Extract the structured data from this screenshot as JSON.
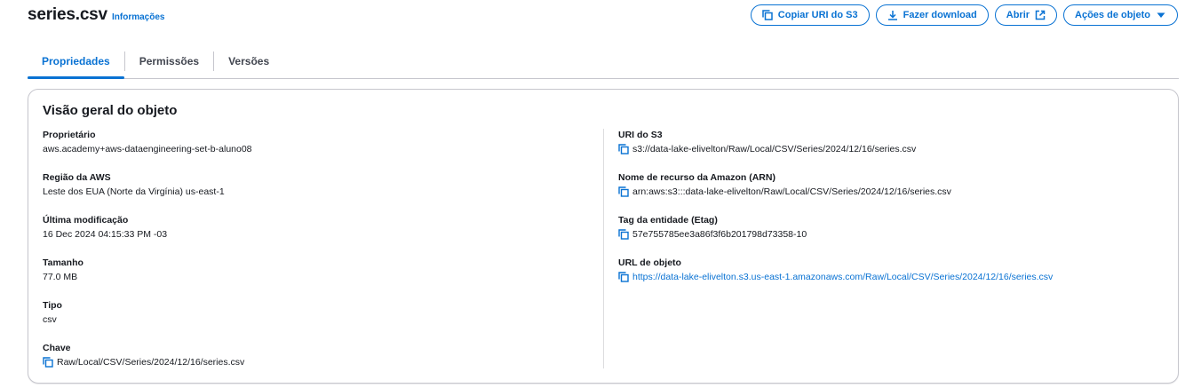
{
  "header": {
    "title": "series.csv",
    "info_link": "Informações"
  },
  "actions": {
    "copy_uri": "Copiar URI do S3",
    "download": "Fazer download",
    "open": "Abrir",
    "object_actions": "Ações de objeto"
  },
  "tabs": [
    {
      "label": "Propriedades",
      "active": true
    },
    {
      "label": "Permissões",
      "active": false
    },
    {
      "label": "Versões",
      "active": false
    }
  ],
  "overview": {
    "title": "Visão geral do objeto",
    "left": [
      {
        "label": "Proprietário",
        "value": "aws.academy+aws-dataengineering-set-b-aluno08"
      },
      {
        "label": "Região da AWS",
        "value": "Leste dos EUA (Norte da Virgínia) us-east-1"
      },
      {
        "label": "Última modificação",
        "value": "16 Dec 2024 04:15:33 PM -03"
      },
      {
        "label": "Tamanho",
        "value": "77.0 MB"
      },
      {
        "label": "Tipo",
        "value": "csv"
      },
      {
        "label": "Chave",
        "value": "Raw/Local/CSV/Series/2024/12/16/series.csv"
      }
    ],
    "right": [
      {
        "label": "URI do S3",
        "value": "s3://data-lake-elivelton/Raw/Local/CSV/Series/2024/12/16/series.csv"
      },
      {
        "label": "Nome de recurso da Amazon (ARN)",
        "value": "arn:aws:s3:::data-lake-elivelton/Raw/Local/CSV/Series/2024/12/16/series.csv"
      },
      {
        "label": "Tag da entidade (Etag)",
        "value": "57e755785ee3a86f3f6b201798d73358-10"
      },
      {
        "label": "URL de objeto",
        "value": "https://data-lake-elivelton.s3.us-east-1.amazonaws.com/Raw/Local/CSV/Series/2024/12/16/series.csv"
      }
    ]
  },
  "icons": {
    "copy": "copy-icon",
    "download": "download-icon",
    "external": "external-link-icon",
    "caret": "caret-down-icon"
  },
  "colors": {
    "accent": "#0972d3",
    "text": "#16191f",
    "border": "#c6c6cd"
  }
}
